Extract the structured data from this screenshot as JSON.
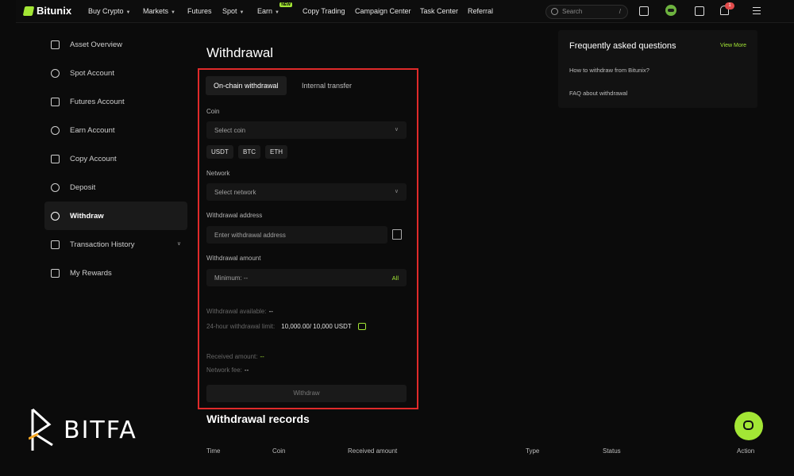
{
  "brand": {
    "name": "Bitunix",
    "accent": "#a3e635",
    "highlight": "#e02a2a"
  },
  "nav": {
    "items": [
      {
        "label": "Buy Crypto",
        "dropdown": true
      },
      {
        "label": "Markets",
        "dropdown": true
      },
      {
        "label": "Futures",
        "dropdown": false
      },
      {
        "label": "Spot",
        "dropdown": true
      },
      {
        "label": "Earn",
        "dropdown": true,
        "badge": "NEW"
      },
      {
        "label": "Copy Trading",
        "dropdown": false
      },
      {
        "label": "Campaign Center",
        "dropdown": false
      },
      {
        "label": "Task Center",
        "dropdown": false
      },
      {
        "label": "Referral",
        "dropdown": false
      }
    ],
    "search_placeholder": "Search",
    "search_shortcut": "/",
    "notifications": "1"
  },
  "sidebar": {
    "items": [
      {
        "label": "Asset Overview",
        "icon": "wallet-icon"
      },
      {
        "label": "Spot Account",
        "icon": "spot-icon"
      },
      {
        "label": "Futures Account",
        "icon": "futures-icon"
      },
      {
        "label": "Earn Account",
        "icon": "earn-icon"
      },
      {
        "label": "Copy Account",
        "icon": "copy-icon"
      },
      {
        "label": "Deposit",
        "icon": "deposit-icon"
      },
      {
        "label": "Withdraw",
        "icon": "withdraw-icon",
        "active": true
      },
      {
        "label": "Transaction History",
        "icon": "history-icon",
        "expandable": true
      },
      {
        "label": "My Rewards",
        "icon": "rewards-icon"
      }
    ]
  },
  "main": {
    "title": "Withdrawal",
    "tabs": [
      "On-chain withdrawal",
      "Internal transfer"
    ],
    "coin": {
      "label": "Coin",
      "placeholder": "Select coin",
      "quick": [
        "USDT",
        "BTC",
        "ETH"
      ]
    },
    "network": {
      "label": "Network",
      "placeholder": "Select network"
    },
    "address": {
      "label": "Withdrawal address",
      "placeholder": "Enter withdrawal address"
    },
    "amount": {
      "label": "Withdrawal amount",
      "placeholder": "Minimum:  --",
      "all": "All"
    },
    "available": {
      "label": "Withdrawal available:",
      "value": "--"
    },
    "limit": {
      "label": "24-hour withdrawal limit:",
      "value": "10,000.00/ 10,000 USDT"
    },
    "received": {
      "label": "Received amount:",
      "value": "--"
    },
    "fee": {
      "label": "Network fee:",
      "value": "--"
    },
    "button": "Withdraw",
    "records_title": "Withdrawal records",
    "columns": [
      "Time",
      "Coin",
      "Received amount",
      "Type",
      "Status",
      "Action"
    ]
  },
  "faq": {
    "title": "Frequently asked questions",
    "more": "View More",
    "items": [
      "How to withdraw from Bitunix?",
      "FAQ about withdrawal"
    ]
  },
  "watermark": {
    "text": "BITFA"
  }
}
